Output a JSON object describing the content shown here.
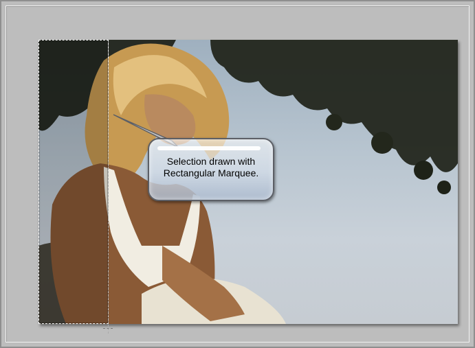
{
  "callout": {
    "text_line1": "Selection drawn with",
    "text_line2": "Rectangular Marquee."
  },
  "colors": {
    "frame_background": "#bdbdbd",
    "selection_border": "#ffffff",
    "callout_border": "#5c5f66"
  },
  "icons": {
    "selection_marquee": "dashed-rectangle",
    "pointer": "crosshair-icon"
  }
}
